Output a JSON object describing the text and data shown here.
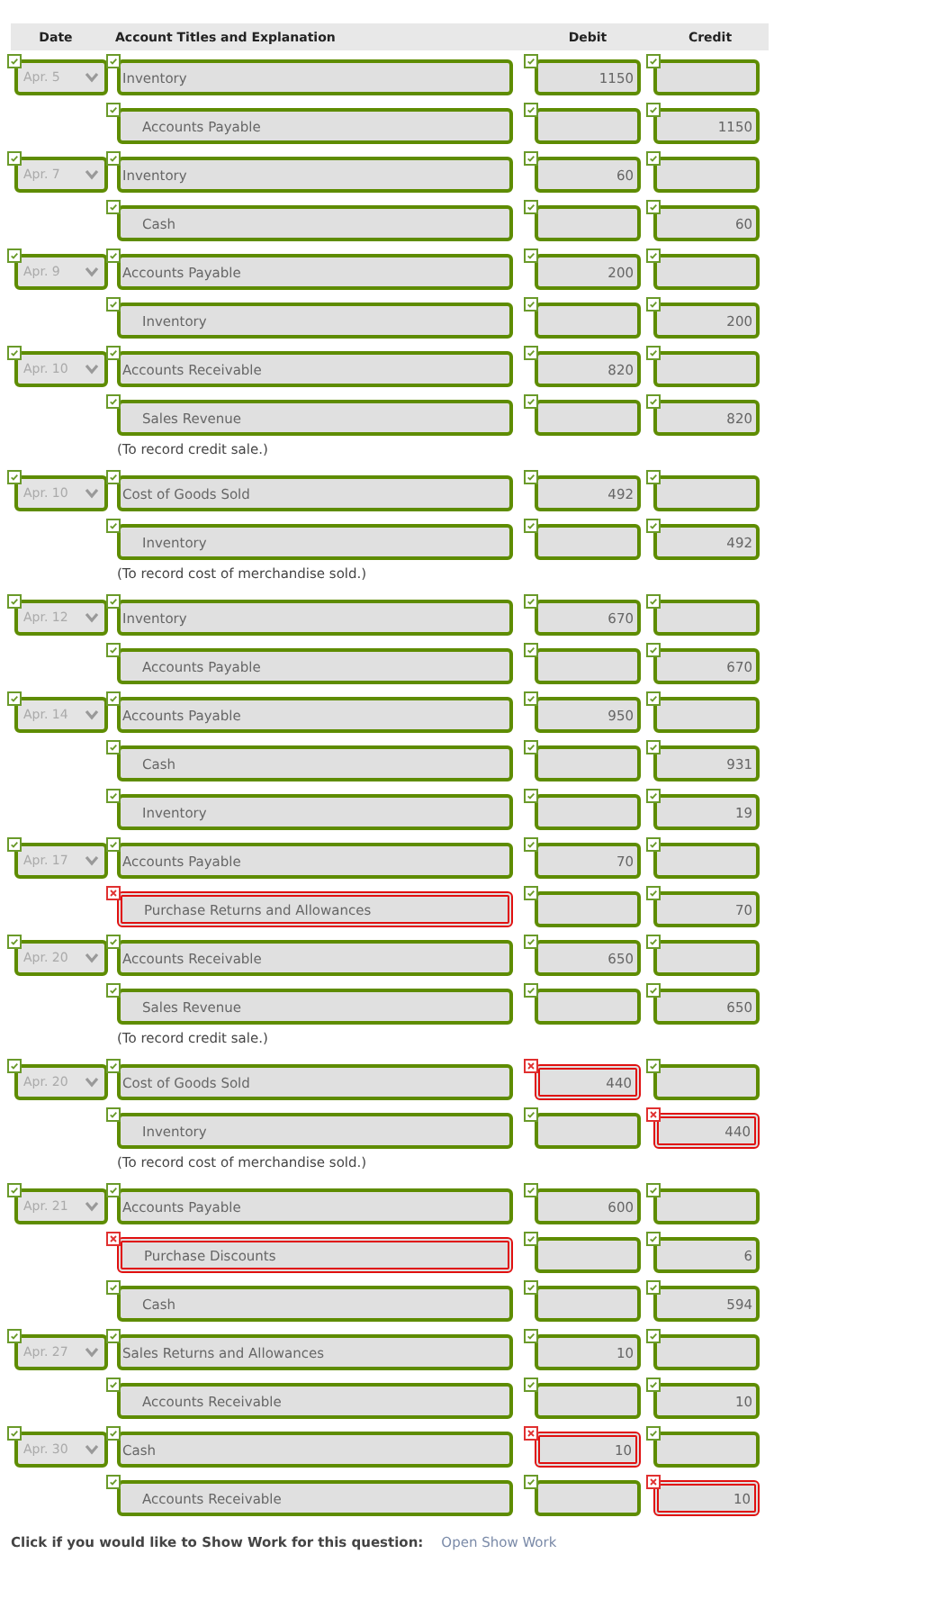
{
  "header": {
    "date": "Date",
    "account": "Account Titles and Explanation",
    "debit": "Debit",
    "credit": "Credit"
  },
  "entries": [
    {
      "date": "Apr. 5",
      "date_correct": true,
      "lines": [
        {
          "kind": "debit",
          "account": "Inventory",
          "account_correct": true,
          "debit": "1150",
          "debit_correct": true,
          "credit_correct": true
        },
        {
          "kind": "credit",
          "account": "Accounts Payable",
          "account_correct": true,
          "debit_correct": true,
          "credit": "1150",
          "credit_correct": true
        }
      ]
    },
    {
      "date": "Apr. 7",
      "date_correct": true,
      "lines": [
        {
          "kind": "debit",
          "account": "Inventory",
          "account_correct": true,
          "debit": "60",
          "debit_correct": true,
          "credit_correct": true
        },
        {
          "kind": "credit",
          "account": "Cash",
          "account_correct": true,
          "debit_correct": true,
          "credit": "60",
          "credit_correct": true
        }
      ]
    },
    {
      "date": "Apr. 9",
      "date_correct": true,
      "lines": [
        {
          "kind": "debit",
          "account": "Accounts Payable",
          "account_correct": true,
          "debit": "200",
          "debit_correct": true,
          "credit_correct": true
        },
        {
          "kind": "credit",
          "account": "Inventory",
          "account_correct": true,
          "debit_correct": true,
          "credit": "200",
          "credit_correct": true
        }
      ]
    },
    {
      "date": "Apr. 10",
      "date_correct": true,
      "lines": [
        {
          "kind": "debit",
          "account": "Accounts Receivable",
          "account_correct": true,
          "debit": "820",
          "debit_correct": true,
          "credit_correct": true
        },
        {
          "kind": "credit",
          "account": "Sales Revenue",
          "account_correct": true,
          "debit_correct": true,
          "credit": "820",
          "credit_correct": true
        }
      ],
      "note": "(To record credit sale.)"
    },
    {
      "date": "Apr. 10",
      "date_correct": true,
      "lines": [
        {
          "kind": "debit",
          "account": "Cost of Goods Sold",
          "account_correct": true,
          "debit": "492",
          "debit_correct": true,
          "credit_correct": true
        },
        {
          "kind": "credit",
          "account": "Inventory",
          "account_correct": true,
          "debit_correct": true,
          "credit": "492",
          "credit_correct": true
        }
      ],
      "note": "(To record cost of merchandise sold.)"
    },
    {
      "date": "Apr. 12",
      "date_correct": true,
      "lines": [
        {
          "kind": "debit",
          "account": "Inventory",
          "account_correct": true,
          "debit": "670",
          "debit_correct": true,
          "credit_correct": true
        },
        {
          "kind": "credit",
          "account": "Accounts Payable",
          "account_correct": true,
          "debit_correct": true,
          "credit": "670",
          "credit_correct": true
        }
      ]
    },
    {
      "date": "Apr. 14",
      "date_correct": true,
      "lines": [
        {
          "kind": "debit",
          "account": "Accounts Payable",
          "account_correct": true,
          "debit": "950",
          "debit_correct": true,
          "credit_correct": true
        },
        {
          "kind": "credit",
          "account": "Cash",
          "account_correct": true,
          "debit_correct": true,
          "credit": "931",
          "credit_correct": true
        },
        {
          "kind": "credit",
          "account": "Inventory",
          "account_correct": true,
          "debit_correct": true,
          "credit": "19",
          "credit_correct": true
        }
      ]
    },
    {
      "date": "Apr. 17",
      "date_correct": true,
      "lines": [
        {
          "kind": "debit",
          "account": "Accounts Payable",
          "account_correct": true,
          "debit": "70",
          "debit_correct": true,
          "credit_correct": true
        },
        {
          "kind": "credit",
          "account": "Purchase Returns and Allowances",
          "account_correct": false,
          "debit_correct": true,
          "credit": "70",
          "credit_correct": true
        }
      ]
    },
    {
      "date": "Apr. 20",
      "date_correct": true,
      "lines": [
        {
          "kind": "debit",
          "account": "Accounts Receivable",
          "account_correct": true,
          "debit": "650",
          "debit_correct": true,
          "credit_correct": true
        },
        {
          "kind": "credit",
          "account": "Sales Revenue",
          "account_correct": true,
          "debit_correct": true,
          "credit": "650",
          "credit_correct": true
        }
      ],
      "note": "(To record credit sale.)"
    },
    {
      "date": "Apr. 20",
      "date_correct": true,
      "lines": [
        {
          "kind": "debit",
          "account": "Cost of Goods Sold",
          "account_correct": true,
          "debit": "440",
          "debit_correct": false,
          "credit_correct": true
        },
        {
          "kind": "credit",
          "account": "Inventory",
          "account_correct": true,
          "debit_correct": true,
          "credit": "440",
          "credit_correct": false
        }
      ],
      "note": "(To record cost of merchandise sold.)"
    },
    {
      "date": "Apr. 21",
      "date_correct": true,
      "lines": [
        {
          "kind": "debit",
          "account": "Accounts Payable",
          "account_correct": true,
          "debit": "600",
          "debit_correct": true,
          "credit_correct": true
        },
        {
          "kind": "credit",
          "account": "Purchase Discounts",
          "account_correct": false,
          "debit_correct": true,
          "credit": "6",
          "credit_correct": true
        },
        {
          "kind": "credit",
          "account": "Cash",
          "account_correct": true,
          "debit_correct": true,
          "credit": "594",
          "credit_correct": true
        }
      ]
    },
    {
      "date": "Apr. 27",
      "date_correct": true,
      "lines": [
        {
          "kind": "debit",
          "account": "Sales Returns and Allowances",
          "account_correct": true,
          "debit": "10",
          "debit_correct": true,
          "credit_correct": true
        },
        {
          "kind": "credit",
          "account": "Accounts Receivable",
          "account_correct": true,
          "debit_correct": true,
          "credit": "10",
          "credit_correct": true
        }
      ]
    },
    {
      "date": "Apr. 30",
      "date_correct": true,
      "lines": [
        {
          "kind": "debit",
          "account": "Cash",
          "account_correct": true,
          "debit": "10",
          "debit_correct": false,
          "credit_correct": true
        },
        {
          "kind": "credit",
          "account": "Accounts Receivable",
          "account_correct": true,
          "debit_correct": true,
          "credit": "10",
          "credit_correct": false
        }
      ]
    }
  ],
  "footer": {
    "prompt": "Click if you would like to Show Work for this question:",
    "link": "Open Show Work"
  }
}
